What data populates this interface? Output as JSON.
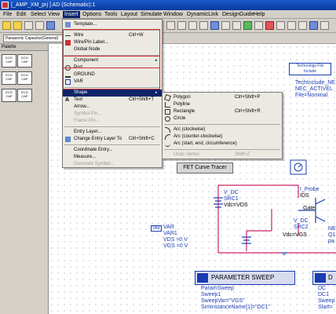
{
  "window": {
    "title": "[_AMP_XM_prj ] AD (Schematic):1"
  },
  "menubar": [
    "File",
    "Edit",
    "Select",
    "View",
    "Insert",
    "Options",
    "Tools",
    "Layout",
    "Simulate",
    "Window",
    "DynamicLink",
    "DesignGuide",
    "Help"
  ],
  "toolbar2": {
    "component_combo": "Panasonic Capacitor(General)"
  },
  "palette": {
    "title": "Palette",
    "items": [
      "ECG CAP",
      "ECG CAP",
      "ECG CAP",
      "ECG CAP",
      "ECG CAP",
      "ECG CAP"
    ]
  },
  "insert_menu": {
    "items": [
      {
        "label": "Template...",
        "shortcut": "",
        "disabled": false
      },
      {
        "label": "Wire",
        "shortcut": "Ctrl+W",
        "disabled": false
      },
      {
        "label": "Wire/Pin Label...",
        "shortcut": "",
        "disabled": false
      },
      {
        "label": "Global Node",
        "shortcut": "",
        "disabled": false
      },
      {
        "label": "Component",
        "shortcut": "",
        "disabled": false
      },
      {
        "label": "Port",
        "shortcut": "",
        "disabled": false
      },
      {
        "label": "GROUND",
        "shortcut": "",
        "disabled": false
      },
      {
        "label": "VAR",
        "shortcut": "",
        "disabled": false
      },
      {
        "label": "Shape",
        "shortcut": "",
        "disabled": false
      },
      {
        "label": "Text",
        "shortcut": "Ctrl+Shift+T",
        "disabled": false
      },
      {
        "label": "Arrow...",
        "shortcut": "",
        "disabled": false
      },
      {
        "label": "Symbol Pin...",
        "shortcut": "",
        "disabled": true
      },
      {
        "label": "Frame Pin...",
        "shortcut": "",
        "disabled": true
      },
      {
        "label": "Entry Layer...",
        "shortcut": "",
        "disabled": false
      },
      {
        "label": "Change Entry Layer To",
        "shortcut": "Ctrl+Shift+C",
        "disabled": false
      },
      {
        "label": "Coordinate Entry...",
        "shortcut": "",
        "disabled": false
      },
      {
        "label": "Measure...",
        "shortcut": "",
        "disabled": false
      },
      {
        "label": "Generate Symbol...",
        "shortcut": "",
        "disabled": true
      }
    ]
  },
  "shape_submenu": {
    "items": [
      {
        "label": "Polygon",
        "shortcut": "Ctrl+Shift+P",
        "disabled": false
      },
      {
        "label": "Polyline",
        "shortcut": "",
        "disabled": false
      },
      {
        "label": "Rectangle",
        "shortcut": "Ctrl+Shift+R",
        "disabled": false
      },
      {
        "label": "Circle",
        "shortcut": "",
        "disabled": false
      },
      {
        "label": "Arc (clockwise)",
        "shortcut": "",
        "disabled": false
      },
      {
        "label": "Arc (counter-clockwise)",
        "shortcut": "",
        "disabled": false
      },
      {
        "label": "Arc (start, end, circumference)",
        "shortcut": "",
        "disabled": false
      },
      {
        "label": "Undo Vertex",
        "shortcut": "Shift+Z",
        "disabled": true
      }
    ]
  },
  "canvas": {
    "tech_file": {
      "line1": "Technology File",
      "line2": "Include"
    },
    "tech_labels": [
      "TechInclude_NE",
      "NEC_ACTIVEL",
      "File=Nominal"
    ],
    "fet_button": "FET Curve Tracer",
    "vdc_src1": [
      "V_DC",
      "SRC1",
      "Vdc=VDS"
    ],
    "iprobe": [
      "I_Probe",
      "IDS"
    ],
    "gate": "Gate",
    "vdc_src2": [
      "V_DC",
      "SRC2",
      "Vdc=VGS"
    ],
    "q1_labels": [
      "NE",
      "Q1",
      "pa"
    ],
    "var": {
      "icon": "VAR",
      "lines": [
        "VAR",
        "VAR1",
        "VDS =0 V",
        "VGS =0 V"
      ]
    },
    "param_sweep": {
      "title": "PARAMETER SWEEP",
      "lines": [
        "ParamSweep",
        "Sweep1",
        "SweepVar=\"VGS\"",
        "SimInstanceName[1]=\"DC1\""
      ]
    },
    "dc": {
      "title": "D",
      "lines": [
        "DC",
        "DC1",
        "Sweep",
        "Start="
      ]
    }
  },
  "colors": {
    "accent": "#0a246a",
    "wire": "#cc2266",
    "label": "#1a3cb0"
  }
}
